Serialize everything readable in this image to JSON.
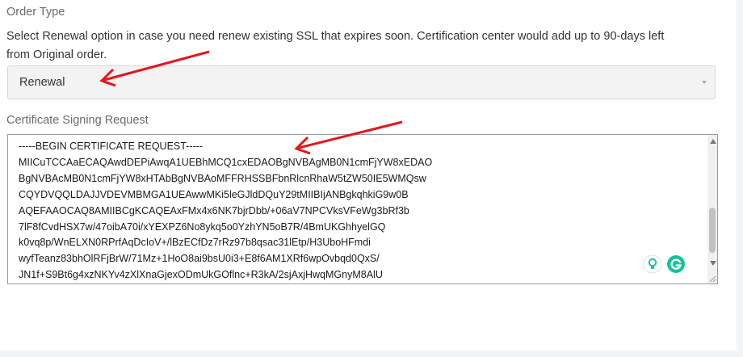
{
  "order_type": {
    "label": "Order Type",
    "help_line1": "Select Renewal option in case you need renew existing SSL that expires soon. Certification center would add up to 90-days left",
    "help_line2": "from Original order.",
    "selected": "Renewal"
  },
  "csr": {
    "label": "Certificate Signing Request",
    "value": "-----BEGIN CERTIFICATE REQUEST-----\nMIICuTCCAaECAQAwdDEPiAwqA1UEBhMCQ1cxEDAOBgNVBAgMB0N1cmFjYW8xEDAO\nBgNVBAcMB0N1cmFjYW8xHTAbBgNVBAoMFFRHSSBFbnRlcnRhaW5tZW50IE5WMQsw\nCQYDVQQLDAJJVDEVMBMGA1UEAwwMKi5leGJldDQuY29tMIIBIjANBgkqhkiG9w0B\nAQEFAAOCAQ8AMIIBCgKCAQEAxFMx4x6NK7bjrDbb/+06aV7NPCVksVFeWg3bRf3b\n7lF8fCvdHSX7w/47oibA70i/xYEXPZ6No8ykq5o0YzhYN5oB7R/4BmUKGhhyelGQ\nk0vq8p/WnELXN0RPrfAqDcIoV+/lBzECfDz7rRz97b8qsac31lEtp/H3UboHFmdi\nwyfTeanz83bhOlRFjBrW/71Mz+1HoO8ai9bsU0i3+E8f6AM1XRf6wpOvbqd0QxS/\nJN1f+S9Bt6g4xzNKYv4zXlXnaGjexODmUkGOflnc+R3kA/2sjAxjHwqMGnyM8AlU"
  },
  "colors": {
    "annotation_arrow": "#e8141b",
    "grammarly_green": "#15c39a"
  },
  "icons": [
    "chevron-down-icon",
    "scroll-up-icon",
    "scroll-down-icon",
    "resize-grip-icon",
    "lightbulb-icon",
    "grammarly-icon",
    "annotation-arrow"
  ]
}
